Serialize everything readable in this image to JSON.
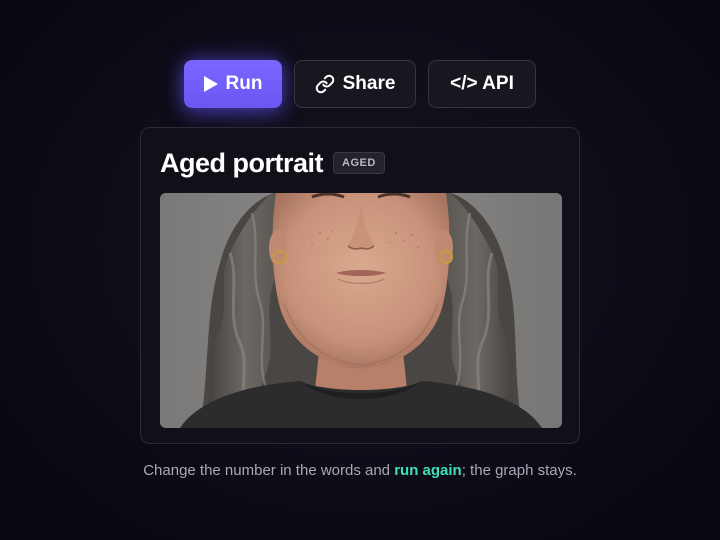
{
  "toolbar": {
    "run_label": "Run",
    "share_label": "Share",
    "api_label": "</> API",
    "run_icon": "play-icon",
    "share_icon": "link-icon",
    "accent_color": "#6c5cff"
  },
  "card": {
    "title": "Aged portrait",
    "badge": "AGED",
    "image_subject": "portrait of a middle-aged woman with long wavy gray hair wearing a dark sweater"
  },
  "caption": {
    "before": "Change the number in the words and ",
    "highlight": "run again",
    "after": "; the graph stays.",
    "highlight_color": "#3fe0b8"
  }
}
